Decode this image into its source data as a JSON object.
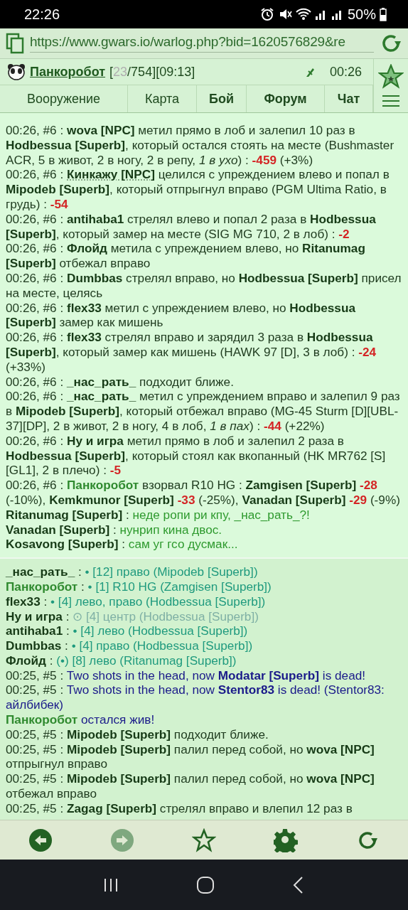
{
  "status_bar": {
    "time": "22:26",
    "battery": "50%"
  },
  "address_bar": {
    "url": "https://www.gwars.io/warlog.php?bid=1620576829&re"
  },
  "header": {
    "player": "Панкоробот",
    "hp_open": "[",
    "hp": "23",
    "hp_rest": "/754][09:13]",
    "clock": "00:26"
  },
  "tabs": [
    {
      "label": "Вооружение",
      "bold": false
    },
    {
      "label": "Карта",
      "bold": false
    },
    {
      "label": "Бой",
      "bold": true
    },
    {
      "label": "Форум",
      "bold": true
    },
    {
      "label": "Чат",
      "bold": true
    }
  ],
  "log": {
    "sections": [
      {
        "kind": "battle",
        "entries": [
          {
            "parts": [
              {
                "kind": "plain",
                "text": "00:26, #6 : "
              },
              {
                "kind": "name",
                "text": "wova [NPC]"
              },
              {
                "kind": "plain",
                "text": " метил прямо в лоб и залепил 10 раз в "
              },
              {
                "kind": "name",
                "text": "Hodbessua [Superb]"
              },
              {
                "kind": "plain",
                "text": ", который остался стоять на месте (Bushmaster ACR, 5 в живот, 2 в ногу, 2 в репу, *1 в ухо*) : "
              },
              {
                "kind": "dmg",
                "text": "-459"
              },
              {
                "kind": "plain",
                "text": " (+3%)"
              }
            ]
          },
          {
            "parts": [
              {
                "kind": "plain",
                "text": "00:26, #6 : "
              },
              {
                "kind": "npc",
                "text": "Кинкажу [NPC]"
              },
              {
                "kind": "plain",
                "text": " целился с упреждением влево и попал в "
              },
              {
                "kind": "name",
                "text": "Mipodeb [Superb]"
              },
              {
                "kind": "plain",
                "text": ", который отпрыгнул вправо (PGM Ultima Ratio, в грудь) : "
              },
              {
                "kind": "dmg",
                "text": "-54"
              }
            ]
          },
          {
            "parts": [
              {
                "kind": "plain",
                "text": "00:26, #6 : "
              },
              {
                "kind": "name",
                "text": "antihaba1"
              },
              {
                "kind": "plain",
                "text": " стрелял влево и попал 2 раза в "
              },
              {
                "kind": "name",
                "text": "Hodbessua [Superb]"
              },
              {
                "kind": "plain",
                "text": ", который замер на месте (SIG MG 710, 2 в лоб) : "
              },
              {
                "kind": "dmg",
                "text": "-2"
              }
            ]
          },
          {
            "parts": [
              {
                "kind": "plain",
                "text": "00:26, #6 : "
              },
              {
                "kind": "name",
                "text": "Флойд"
              },
              {
                "kind": "plain",
                "text": " метила с упреждением влево, но "
              },
              {
                "kind": "name",
                "text": "Ritanumag [Superb]"
              },
              {
                "kind": "plain",
                "text": " отбежал вправо"
              }
            ]
          },
          {
            "parts": [
              {
                "kind": "plain",
                "text": "00:26, #6 : "
              },
              {
                "kind": "name",
                "text": "Dumbbas"
              },
              {
                "kind": "plain",
                "text": " стрелял вправо, но "
              },
              {
                "kind": "name",
                "text": "Hodbessua [Superb]"
              },
              {
                "kind": "plain",
                "text": " присел на месте, целясь"
              }
            ]
          },
          {
            "parts": [
              {
                "kind": "plain",
                "text": "00:26, #6 : "
              },
              {
                "kind": "name",
                "text": "flex33"
              },
              {
                "kind": "plain",
                "text": " метил с упреждением влево, но "
              },
              {
                "kind": "name",
                "text": "Hodbessua [Superb]"
              },
              {
                "kind": "plain",
                "text": " замер как мишень"
              }
            ]
          },
          {
            "parts": [
              {
                "kind": "plain",
                "text": "00:26, #6 : "
              },
              {
                "kind": "name",
                "text": "flex33"
              },
              {
                "kind": "plain",
                "text": " стрелял вправо и зарядил 3 раза в "
              },
              {
                "kind": "name",
                "text": "Hodbessua [Superb]"
              },
              {
                "kind": "plain",
                "text": ", который замер как мишень (HAWK 97 [D], 3 в лоб) : "
              },
              {
                "kind": "dmg",
                "text": "-24"
              },
              {
                "kind": "plain",
                "text": " (+33%)"
              }
            ]
          },
          {
            "parts": [
              {
                "kind": "plain",
                "text": "00:26, #6 : "
              },
              {
                "kind": "name",
                "text": "_нас_рать_"
              },
              {
                "kind": "plain",
                "text": " подходит ближе."
              }
            ]
          },
          {
            "parts": [
              {
                "kind": "plain",
                "text": "00:26, #6 : "
              },
              {
                "kind": "name",
                "text": "_нас_рать_"
              },
              {
                "kind": "plain",
                "text": " метил с упреждением вправо и залепил 9 раз в "
              },
              {
                "kind": "name",
                "text": "Mipodeb [Superb]"
              },
              {
                "kind": "plain",
                "text": ", который отбежал вправо (MG-45 Sturm [D][UBL-37][DP], 2 в живот, 2 в ногу, 4 в лоб, *1 в пах*) : "
              },
              {
                "kind": "dmg",
                "text": "-44"
              },
              {
                "kind": "plain",
                "text": " (+22%)"
              }
            ]
          },
          {
            "parts": [
              {
                "kind": "plain",
                "text": "00:26, #6 : "
              },
              {
                "kind": "name",
                "text": "Ну и игра"
              },
              {
                "kind": "plain",
                "text": " метил прямо в лоб и залепил 2 раза в "
              },
              {
                "kind": "name",
                "text": "Hodbessua [Superb]"
              },
              {
                "kind": "plain",
                "text": ", который стоял как вкопанный (HK MR762 [S][GL1], 2 в плечо) : "
              },
              {
                "kind": "dmg",
                "text": "-5"
              }
            ]
          },
          {
            "parts": [
              {
                "kind": "plain",
                "text": "00:26, #6 : "
              },
              {
                "kind": "self",
                "text": "Панкоробот"
              },
              {
                "kind": "plain",
                "text": " взорвал R10 HG : "
              },
              {
                "kind": "name",
                "text": "Zamgisen [Superb] "
              },
              {
                "kind": "dmg",
                "text": "-28"
              },
              {
                "kind": "plain",
                "text": " (-10%), "
              },
              {
                "kind": "name",
                "text": "Kemkmunor [Superb] "
              },
              {
                "kind": "dmg",
                "text": "-33"
              },
              {
                "kind": "plain",
                "text": " (-25%), "
              },
              {
                "kind": "name",
                "text": "Vanadan [Superb] "
              },
              {
                "kind": "dmg",
                "text": "-29"
              },
              {
                "kind": "plain",
                "text": " (-9%)"
              }
            ]
          },
          {
            "parts": [
              {
                "kind": "name",
                "text": "Ritanumag [Superb]"
              },
              {
                "kind": "plain",
                "text": " : "
              },
              {
                "kind": "chat",
                "text": "неде ропи ри кпу, _нас_рать_?!"
              }
            ]
          },
          {
            "parts": [
              {
                "kind": "name",
                "text": "Vanadan [Superb]"
              },
              {
                "kind": "plain",
                "text": " : "
              },
              {
                "kind": "chat",
                "text": "нунрип кина двос."
              }
            ]
          },
          {
            "parts": [
              {
                "kind": "name",
                "text": "Kosavong [Superb]"
              },
              {
                "kind": "plain",
                "text": " : "
              },
              {
                "kind": "chat",
                "text": "сам уг гсо дусмак..."
              }
            ]
          }
        ]
      },
      {
        "kind": "orders",
        "entries": [
          {
            "parts": [
              {
                "kind": "name",
                "text": "_нас_рать_"
              },
              {
                "kind": "plain",
                "text": " : "
              },
              {
                "kind": "order",
                "text": "• [12] право (Mipodeb [Superb])"
              }
            ]
          },
          {
            "parts": [
              {
                "kind": "self",
                "text": "Панкоробот"
              },
              {
                "kind": "plain",
                "text": " : "
              },
              {
                "kind": "order",
                "text": "• [1] R10 HG (Zamgisen [Superb])"
              }
            ]
          },
          {
            "parts": [
              {
                "kind": "name",
                "text": "flex33"
              },
              {
                "kind": "plain",
                "text": " : "
              },
              {
                "kind": "order",
                "text": "• [4] лево, право (Hodbessua [Superb])"
              }
            ]
          },
          {
            "parts": [
              {
                "kind": "name",
                "text": "Ну и игра"
              },
              {
                "kind": "plain",
                "text": " : "
              },
              {
                "kind": "order_dim",
                "text": "⊙ [4] центр (Hodbessua [Superb])"
              }
            ]
          },
          {
            "parts": [
              {
                "kind": "name",
                "text": "antihaba1"
              },
              {
                "kind": "plain",
                "text": " : "
              },
              {
                "kind": "order",
                "text": "• [4] лево (Hodbessua [Superb])"
              }
            ]
          },
          {
            "parts": [
              {
                "kind": "name",
                "text": "Dumbbas"
              },
              {
                "kind": "plain",
                "text": " : "
              },
              {
                "kind": "order",
                "text": "• [4] право (Hodbessua [Superb])"
              }
            ]
          },
          {
            "parts": [
              {
                "kind": "name",
                "text": "Флойд"
              },
              {
                "kind": "plain",
                "text": " : "
              },
              {
                "kind": "order",
                "text": "(•) [8] лево (Ritanumag [Superb])"
              }
            ]
          },
          {
            "parts": [
              {
                "kind": "plain",
                "text": "00:25, #5 : "
              },
              {
                "kind": "event",
                "text": "Two shots in the head, now "
              },
              {
                "kind": "event_name",
                "text": "Modatar [Superb]"
              },
              {
                "kind": "event",
                "text": " is dead!"
              }
            ]
          },
          {
            "parts": [
              {
                "kind": "plain",
                "text": "00:25, #5 : "
              },
              {
                "kind": "event",
                "text": "Two shots in the head, now "
              },
              {
                "kind": "event_name",
                "text": "Stentor83"
              },
              {
                "kind": "event",
                "text": " is dead! (Stentor83: айлбибек)"
              }
            ]
          },
          {
            "parts": [
              {
                "kind": "self",
                "text": "Панкоробот"
              },
              {
                "kind": "event",
                "text": " остался жив!"
              }
            ]
          },
          {
            "parts": [
              {
                "kind": "plain",
                "text": "00:25, #5 : "
              },
              {
                "kind": "name",
                "text": "Mipodeb [Superb]"
              },
              {
                "kind": "plain",
                "text": " подходит ближе."
              }
            ]
          },
          {
            "parts": [
              {
                "kind": "plain",
                "text": "00:25, #5 : "
              },
              {
                "kind": "name",
                "text": "Mipodeb [Superb]"
              },
              {
                "kind": "plain",
                "text": " палил перед собой, но "
              },
              {
                "kind": "name",
                "text": "wova [NPC]"
              },
              {
                "kind": "plain",
                "text": " отпрыгнул вправо"
              }
            ]
          },
          {
            "parts": [
              {
                "kind": "plain",
                "text": "00:25, #5 : "
              },
              {
                "kind": "name",
                "text": "Mipodeb [Superb]"
              },
              {
                "kind": "plain",
                "text": " палил перед собой, но "
              },
              {
                "kind": "name",
                "text": "wova [NPC]"
              },
              {
                "kind": "plain",
                "text": " отбежал вправо"
              }
            ]
          },
          {
            "parts": [
              {
                "kind": "plain",
                "text": "00:25, #5 : "
              },
              {
                "kind": "name",
                "text": "Zagag [Superb]"
              },
              {
                "kind": "plain",
                "text": " стрелял вправо и влепил 12 раз в"
              }
            ]
          }
        ]
      }
    ]
  },
  "toolbar": [
    {
      "kind": "back",
      "disabled": false
    },
    {
      "kind": "forward",
      "disabled": true
    },
    {
      "kind": "star",
      "disabled": false
    },
    {
      "kind": "settings",
      "disabled": false
    },
    {
      "kind": "reload",
      "disabled": false
    }
  ]
}
